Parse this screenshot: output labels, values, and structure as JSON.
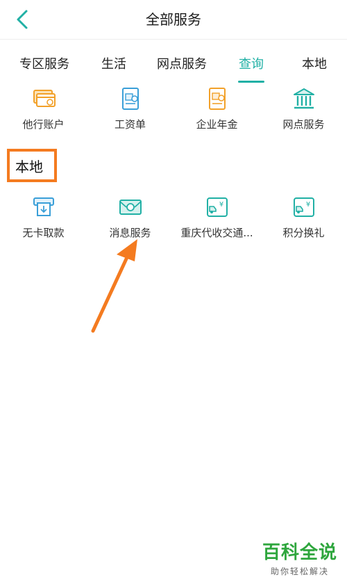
{
  "header": {
    "title": "全部服务"
  },
  "tabs": [
    {
      "label": "专区服务"
    },
    {
      "label": "生活"
    },
    {
      "label": "网点服务"
    },
    {
      "label": "查询",
      "active": true
    },
    {
      "label": "本地"
    }
  ],
  "query_items": [
    {
      "label": "他行账户",
      "icon": "card-icon"
    },
    {
      "label": "工资单",
      "icon": "salary-icon"
    },
    {
      "label": "企业年金",
      "icon": "annuity-icon"
    },
    {
      "label": "网点服务",
      "icon": "bank-icon"
    }
  ],
  "local_section": {
    "title": "本地"
  },
  "local_items": [
    {
      "label": "无卡取款",
      "icon": "atm-icon"
    },
    {
      "label": "消息服务",
      "icon": "envelope-icon"
    },
    {
      "label": "重庆代收交通...",
      "icon": "truck-yuan-icon"
    },
    {
      "label": "积分换礼",
      "icon": "truck-yuan-icon"
    }
  ],
  "watermark": {
    "title": "百科全说",
    "subtitle": "助你轻松解决"
  },
  "colors": {
    "accent": "#21b0a5",
    "orange": "#f47b20",
    "icon_orange": "#f2a12a",
    "icon_teal": "#21b0a5"
  }
}
